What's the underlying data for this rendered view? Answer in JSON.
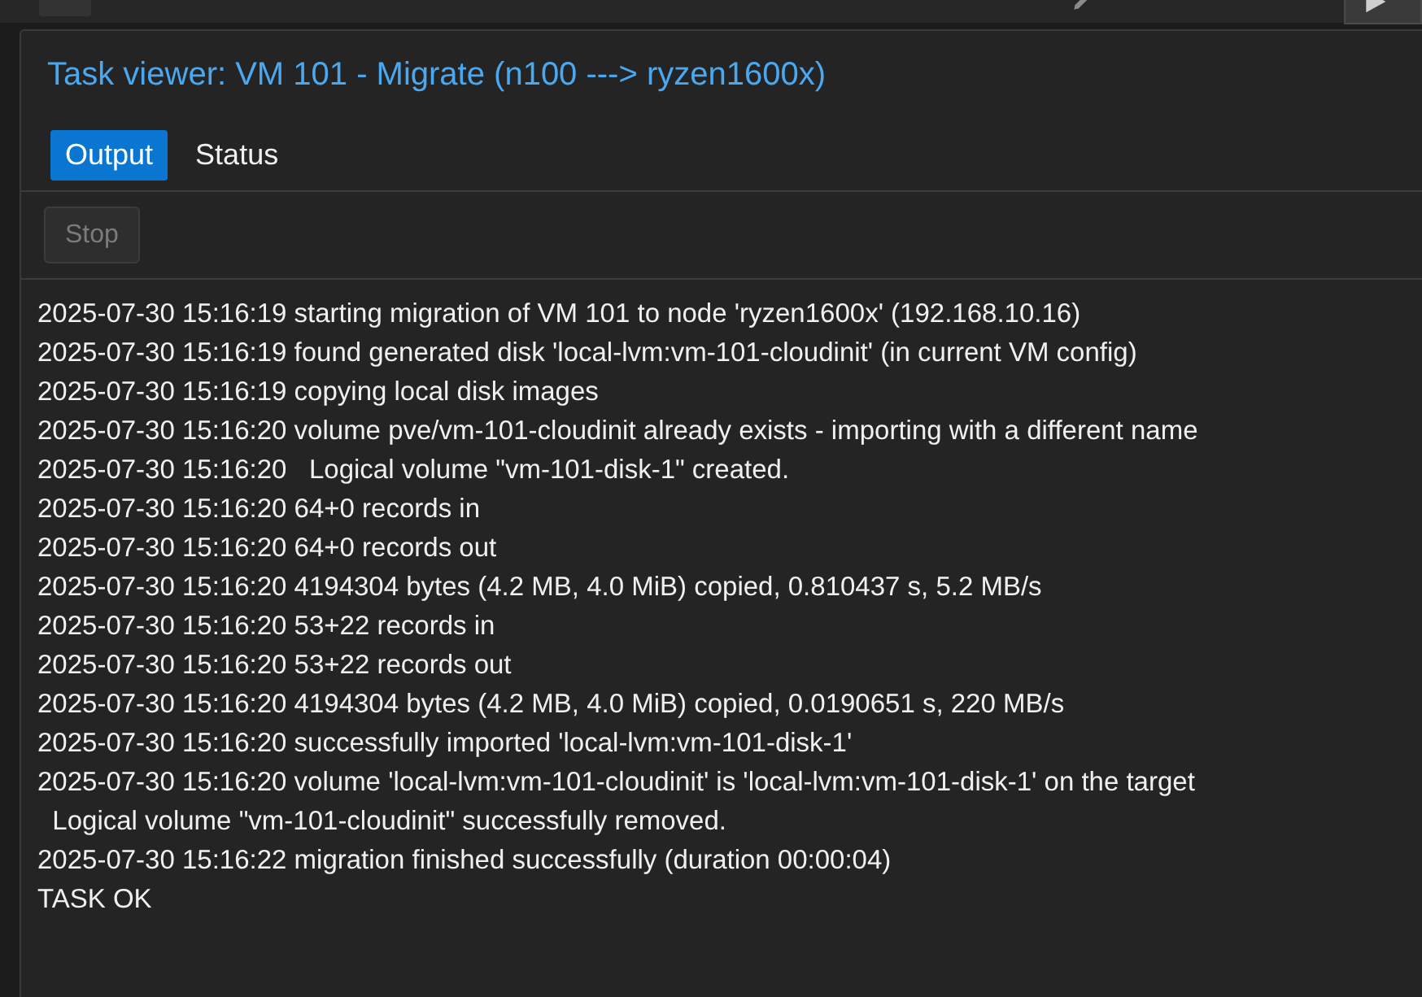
{
  "dialog": {
    "title": "Task viewer: VM 101 - Migrate (n100 ---> ryzen1600x)",
    "tabs": [
      {
        "label": "Output",
        "selected": true
      },
      {
        "label": "Status",
        "selected": false
      }
    ],
    "toolbar": {
      "stop_button": {
        "label": "Stop",
        "disabled": true
      }
    },
    "log_lines": [
      "2025-07-30 15:16:19 starting migration of VM 101 to node 'ryzen1600x' (192.168.10.16)",
      "2025-07-30 15:16:19 found generated disk 'local-lvm:vm-101-cloudinit' (in current VM config)",
      "2025-07-30 15:16:19 copying local disk images",
      "2025-07-30 15:16:20 volume pve/vm-101-cloudinit already exists - importing with a different name",
      "2025-07-30 15:16:20   Logical volume \"vm-101-disk-1\" created.",
      "2025-07-30 15:16:20 64+0 records in",
      "2025-07-30 15:16:20 64+0 records out",
      "2025-07-30 15:16:20 4194304 bytes (4.2 MB, 4.0 MiB) copied, 0.810437 s, 5.2 MB/s",
      "2025-07-30 15:16:20 53+22 records in",
      "2025-07-30 15:16:20 53+22 records out",
      "2025-07-30 15:16:20 4194304 bytes (4.2 MB, 4.0 MiB) copied, 0.0190651 s, 220 MB/s",
      "2025-07-30 15:16:20 successfully imported 'local-lvm:vm-101-disk-1'",
      "2025-07-30 15:16:20 volume 'local-lvm:vm-101-cloudinit' is 'local-lvm:vm-101-disk-1' on the target",
      "  Logical volume \"vm-101-cloudinit\" successfully removed.",
      "2025-07-30 15:16:22 migration finished successfully (duration 00:00:04)",
      "TASK OK"
    ]
  }
}
